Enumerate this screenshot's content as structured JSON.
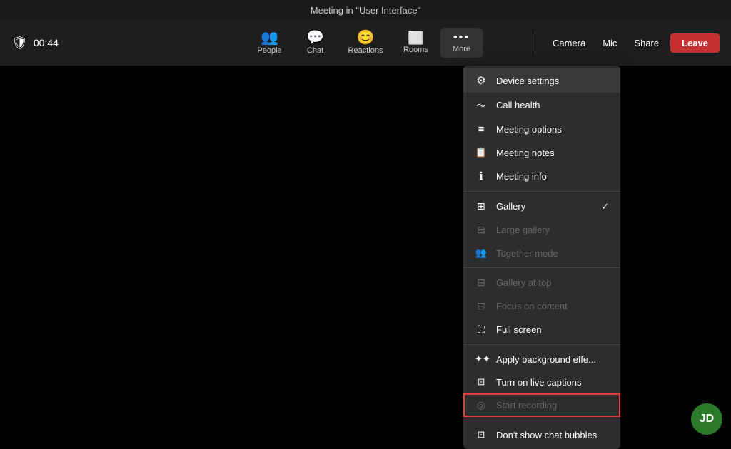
{
  "titleBar": {
    "text": "Meeting in \"User Interface\""
  },
  "toolbar": {
    "timer": "00:44",
    "buttons": [
      {
        "id": "people",
        "icon": "👥",
        "label": "People"
      },
      {
        "id": "chat",
        "icon": "💬",
        "label": "Chat"
      },
      {
        "id": "reactions",
        "icon": "😊",
        "label": "Reactions"
      },
      {
        "id": "rooms",
        "icon": "⬜",
        "label": "Rooms"
      },
      {
        "id": "more",
        "icon": "•••",
        "label": "More"
      }
    ],
    "rightButtons": [
      "Camera",
      "Mic",
      "Share"
    ],
    "leaveLabel": "Leave"
  },
  "dropdown": {
    "items": [
      {
        "id": "device-settings",
        "icon": "⚙",
        "label": "Device settings",
        "disabled": false,
        "checked": false,
        "highlighted": false
      },
      {
        "id": "call-health",
        "icon": "〜",
        "label": "Call health",
        "disabled": false,
        "checked": false,
        "highlighted": false
      },
      {
        "id": "meeting-options",
        "icon": "≡",
        "label": "Meeting options",
        "disabled": false,
        "checked": false,
        "highlighted": false
      },
      {
        "id": "meeting-notes",
        "icon": "📋",
        "label": "Meeting notes",
        "disabled": false,
        "checked": false,
        "highlighted": false
      },
      {
        "id": "meeting-info",
        "icon": "ℹ",
        "label": "Meeting info",
        "disabled": false,
        "checked": false,
        "highlighted": false
      },
      {
        "separator": true
      },
      {
        "id": "gallery",
        "icon": "⊞",
        "label": "Gallery",
        "disabled": false,
        "checked": true,
        "highlighted": false
      },
      {
        "id": "large-gallery",
        "icon": "⊟",
        "label": "Large gallery",
        "disabled": true,
        "checked": false,
        "highlighted": false
      },
      {
        "id": "together-mode",
        "icon": "👥",
        "label": "Together mode",
        "disabled": true,
        "checked": false,
        "highlighted": false
      },
      {
        "separator": true
      },
      {
        "id": "gallery-at-top",
        "icon": "⊟",
        "label": "Gallery at top",
        "disabled": true,
        "checked": false,
        "highlighted": false
      },
      {
        "id": "focus-on-content",
        "icon": "⊟",
        "label": "Focus on content",
        "disabled": true,
        "checked": false,
        "highlighted": false
      },
      {
        "id": "full-screen",
        "icon": "⛶",
        "label": "Full screen",
        "disabled": false,
        "checked": false,
        "highlighted": false
      },
      {
        "separator": true
      },
      {
        "id": "background-effects",
        "icon": "✦",
        "label": "Apply background effe...",
        "disabled": false,
        "checked": false,
        "highlighted": false
      },
      {
        "id": "live-captions",
        "icon": "⊡",
        "label": "Turn on live captions",
        "disabled": false,
        "checked": false,
        "highlighted": false
      },
      {
        "id": "start-recording",
        "icon": "◎",
        "label": "Start recording",
        "disabled": true,
        "checked": false,
        "highlighted": true
      },
      {
        "separator": true
      },
      {
        "id": "chat-bubbles",
        "icon": "⊡",
        "label": "Don't show chat bubbles",
        "disabled": false,
        "checked": false,
        "highlighted": false
      }
    ]
  },
  "avatar": "JD"
}
